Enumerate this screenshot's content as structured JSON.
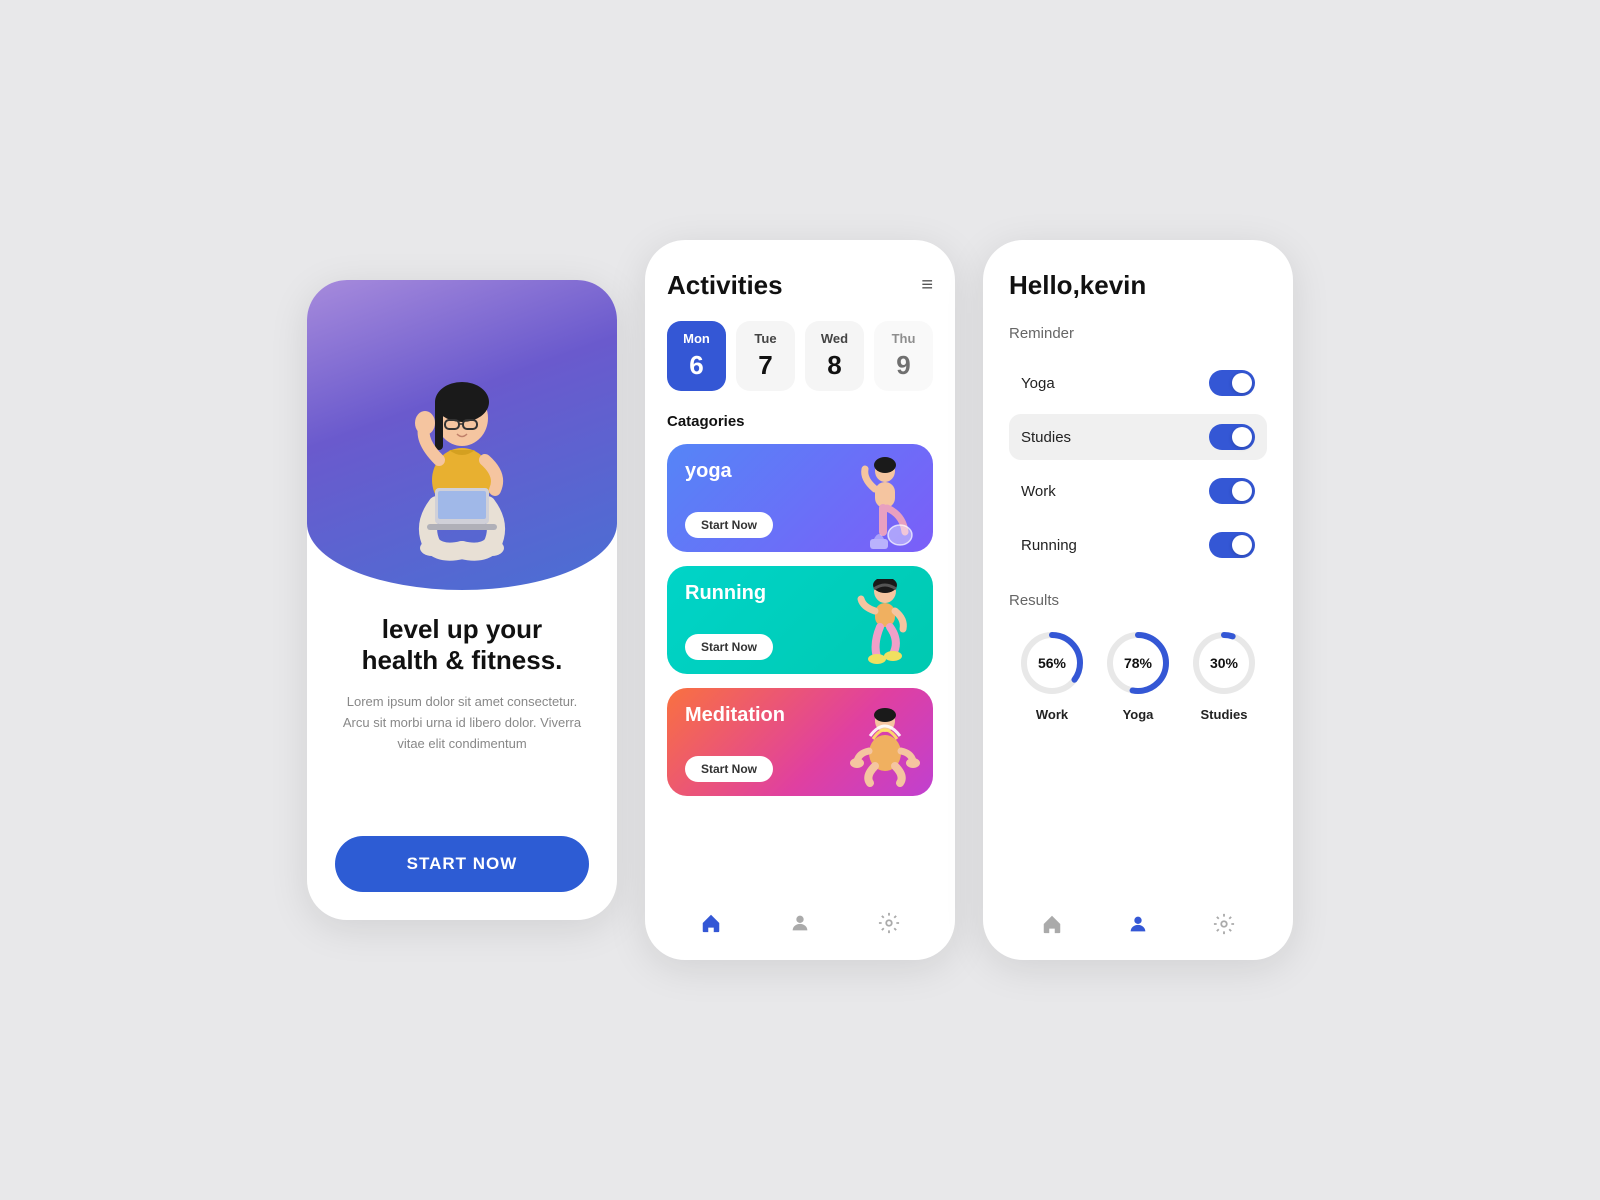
{
  "screen1": {
    "heroAlt": "woman sitting with laptop",
    "title": "level up your\nhealth & fitness.",
    "subtitle": "Lorem ipsum dolor sit amet consectetur. Arcu sit morbi urna id libero dolor. Viverra vitae elit condimentum",
    "startBtn": "START NOW"
  },
  "screen2": {
    "appTitle": "Activities",
    "menuIcon": "≡",
    "days": [
      {
        "name": "Mon",
        "num": "6",
        "active": true
      },
      {
        "name": "Tue",
        "num": "7",
        "active": false
      },
      {
        "name": "Wed",
        "num": "8",
        "active": false
      },
      {
        "name": "Thu",
        "num": "9",
        "active": false,
        "faded": true
      }
    ],
    "categoriesLabel": "Catagories",
    "activities": [
      {
        "name": "yoga",
        "startLabel": "Start Now",
        "color": "yoga"
      },
      {
        "name": "Running",
        "startLabel": "Start Now",
        "color": "running"
      },
      {
        "name": "Meditation",
        "startLabel": "Start Now",
        "color": "meditation"
      }
    ],
    "nav": [
      {
        "icon": "home",
        "active": true
      },
      {
        "icon": "person",
        "active": false
      },
      {
        "icon": "settings",
        "active": false
      }
    ]
  },
  "screen3": {
    "greeting": "Hello,kevin",
    "reminderLabel": "Reminder",
    "toggles": [
      {
        "label": "Yoga",
        "on": true,
        "highlighted": false
      },
      {
        "label": "Studies",
        "on": true,
        "highlighted": true
      },
      {
        "label": "Work",
        "on": true,
        "highlighted": false
      },
      {
        "label": "Running",
        "on": true,
        "highlighted": false
      }
    ],
    "resultsLabel": "Results",
    "results": [
      {
        "label": "Work",
        "pct": 56,
        "color": "#3457d5",
        "radius": 30
      },
      {
        "label": "Yoga",
        "pct": 78,
        "color": "#3457d5",
        "radius": 30
      },
      {
        "label": "Studies",
        "pct": 30,
        "color": "#3457d5",
        "radius": 30
      }
    ],
    "nav": [
      {
        "icon": "home",
        "active": false
      },
      {
        "icon": "person",
        "active": true
      },
      {
        "icon": "settings",
        "active": false
      }
    ]
  }
}
